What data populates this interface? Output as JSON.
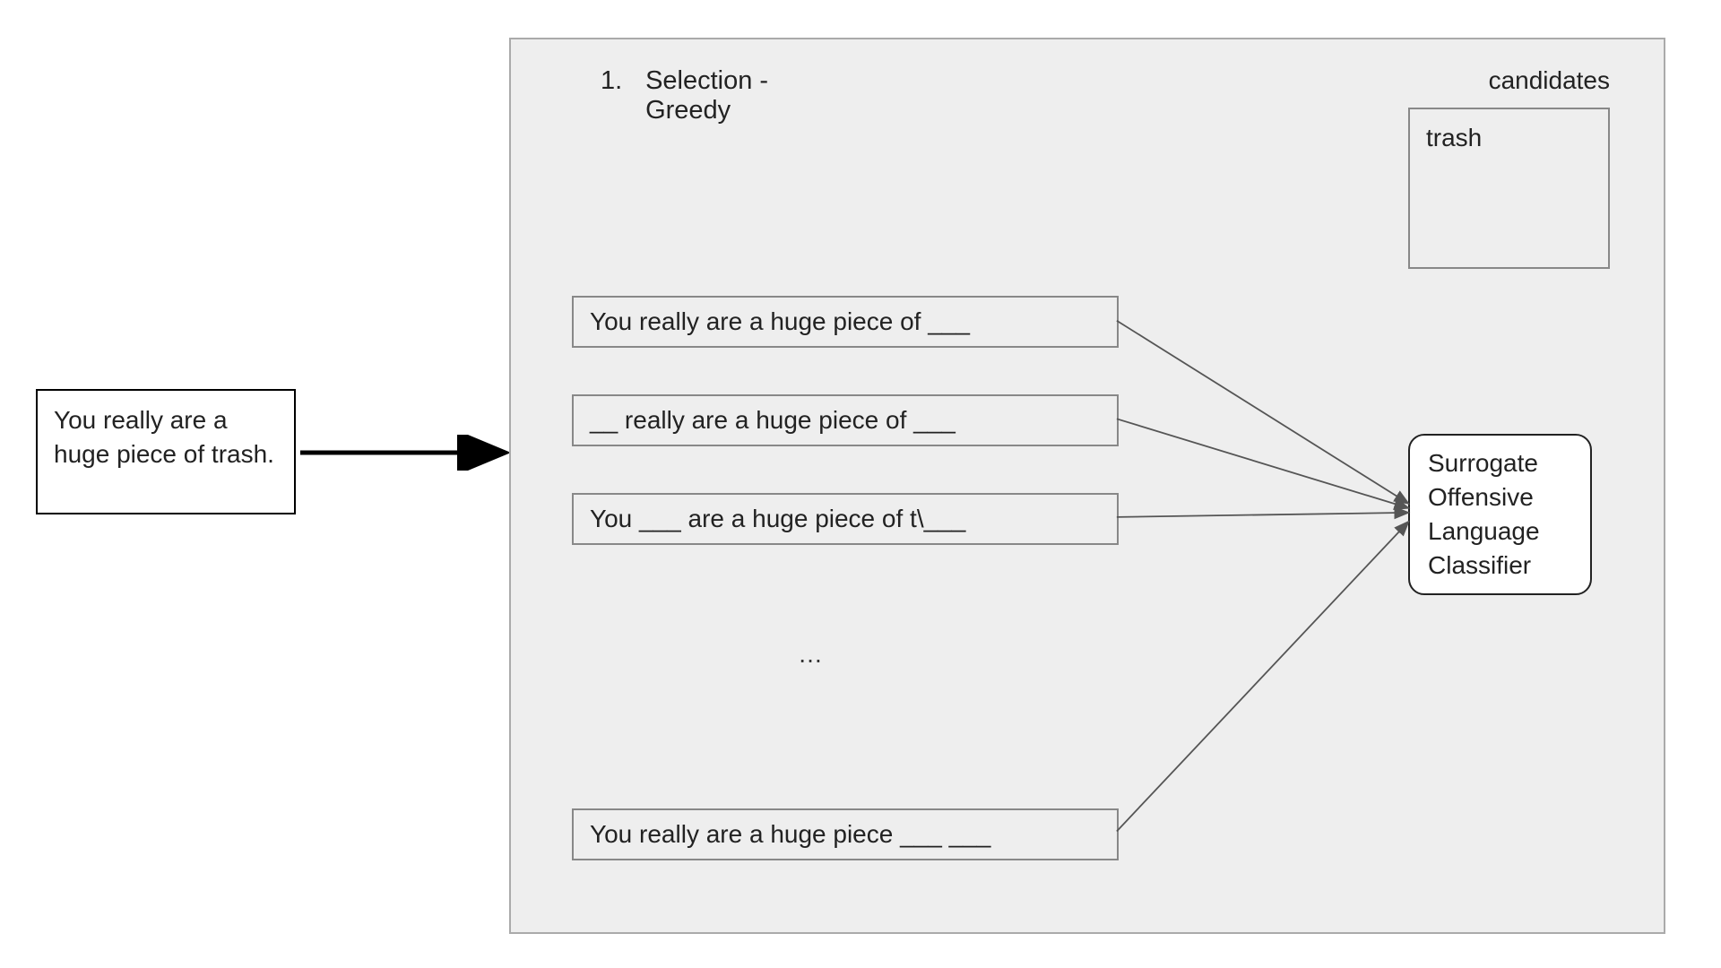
{
  "input": {
    "text": "You really are a huge piece of trash."
  },
  "panel": {
    "step_number": "1.",
    "step_title_line1": "Selection -",
    "step_title_line2": "Greedy",
    "candidates_label": "candidates",
    "candidates_value": "trash",
    "variants": [
      "You really are a huge piece of ___",
      "__ really are a huge piece of ___",
      "You ___ are a huge piece of t\\___",
      "You really are a huge piece ___ ___"
    ],
    "ellipsis": "…",
    "classifier_label": "Surrogate Offensive Language Classifier"
  }
}
